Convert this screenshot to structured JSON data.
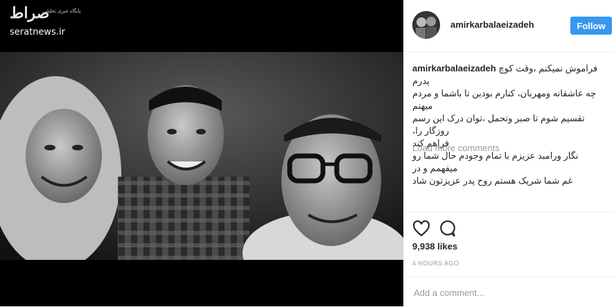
{
  "watermark": {
    "logo_text": "صراط",
    "tagline": "پایگاه خبری تحلیلی",
    "site": "seratnews.ir"
  },
  "post": {
    "username": "amirkarbalaeizadeh",
    "follow_label": "Follow",
    "caption_user": "amirkarbalaeizadeh",
    "caption_lines": [
      "فراموش نمیکنم ،وقت کوچ پدرم",
      "چه عاشقانه ومهربان، کنارم بودین تا باشما و مردم میهنم",
      "تقسیم شوم تا صبر وتحمل ،توان درک این رسم روزگار را،",
      "فراهم کند",
      "نگار ورامبد عزیزم با تمام وجودم حال شما رو میفهمم و در",
      "غم شما شریک هستم روح پدر عزیزتون شاد"
    ],
    "load_more": "Load more comments",
    "likes": "9,938 likes",
    "time": "4 HOURS AGO",
    "comment_placeholder": "Add a comment..."
  },
  "icons": {
    "like": "heart-icon",
    "comment": "comment-icon",
    "more": "more-options-icon"
  },
  "colors": {
    "accent": "#3897f0",
    "text": "#262626",
    "muted": "#999999"
  }
}
